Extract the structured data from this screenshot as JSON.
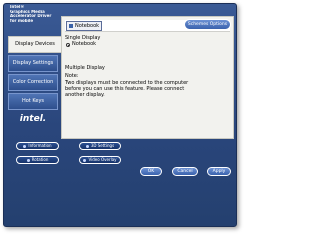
{
  "window": {
    "title_lines": [
      "Intel®",
      "Graphics Media",
      "Accelerator Driver",
      "for mobile"
    ]
  },
  "sidebar": {
    "items": [
      {
        "label": "Display Devices",
        "active": true
      },
      {
        "label": "Display Settings",
        "active": false
      },
      {
        "label": "Color Correction",
        "active": false
      },
      {
        "label": "Hot Keys",
        "active": false
      }
    ],
    "logo": "intel."
  },
  "tabs": [
    {
      "label": "Notebook"
    }
  ],
  "schemes_button": "Schemes Options",
  "single_display": {
    "heading": "Single Display",
    "option_label": "Notebook"
  },
  "multiple_display": {
    "heading": "Multiple Display",
    "note_label": "Note:",
    "note_lines": [
      "Two displays must be connected to the computer",
      "before you can use this feature. Please connect",
      "another display."
    ]
  },
  "bottom_buttons": {
    "information": "Information",
    "tv_settings": "3D Settings",
    "rotation": "Rotation",
    "video_overlay": "Video Overlay"
  },
  "dialog_buttons": {
    "ok": "OK",
    "cancel": "Cancel",
    "apply": "Apply"
  },
  "colors": {
    "window_bg": "#2a467c",
    "panel_bg": "#f2f2ee",
    "button_blue": "#3a62ad"
  }
}
